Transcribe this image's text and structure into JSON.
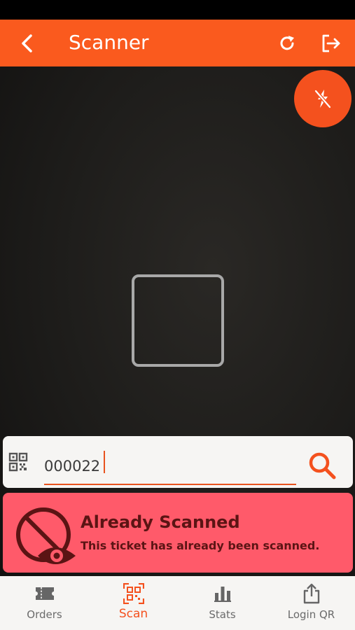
{
  "header": {
    "title": "Scanner",
    "back_icon": "chevron-left-icon",
    "refresh_icon": "refresh-icon",
    "logout_icon": "logout-icon"
  },
  "camera": {
    "flash_icon": "flash-off-icon"
  },
  "search": {
    "value": "000022",
    "qr_icon": "qr-code-icon",
    "search_icon": "search-icon"
  },
  "alert": {
    "title": "Already Scanned",
    "message": "This ticket has already been scanned.",
    "icon": "no-view-icon",
    "color": "#ff5a6a"
  },
  "nav": {
    "items": [
      {
        "label": "Orders",
        "icon": "ticket-icon",
        "active": false
      },
      {
        "label": "Scan",
        "icon": "qr-scan-icon",
        "active": true
      },
      {
        "label": "Stats",
        "icon": "bar-chart-icon",
        "active": false
      },
      {
        "label": "Login QR",
        "icon": "share-icon",
        "active": false
      }
    ]
  },
  "colors": {
    "accent": "#fa5a1e",
    "nav_background": "#f6f5f3"
  }
}
